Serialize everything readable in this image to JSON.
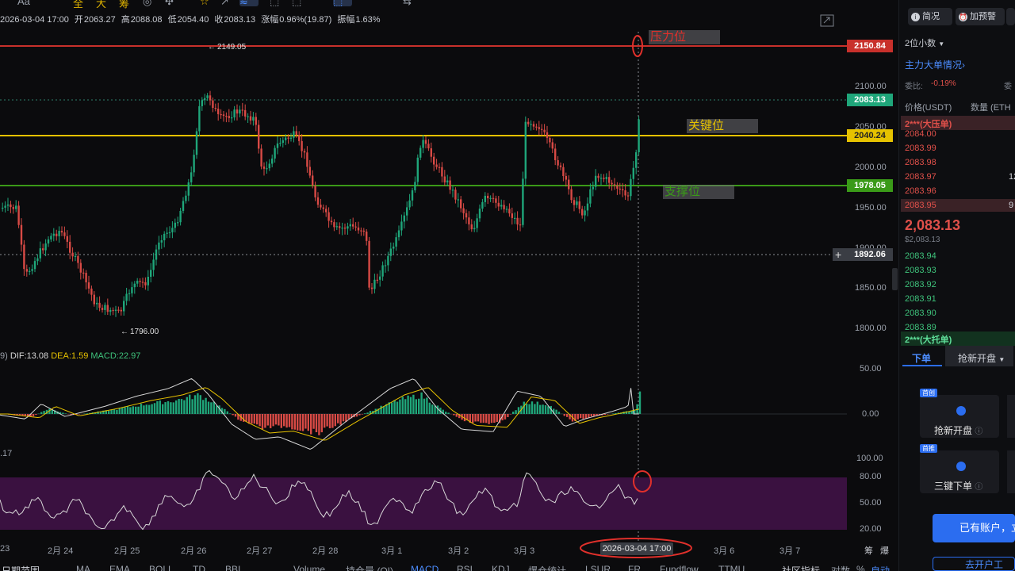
{
  "toolbar": {
    "text_tool": "Aa",
    "items": [
      "全",
      "大",
      "筹",
      "◎",
      "✣",
      "☆",
      "↗",
      "≋",
      "⬚",
      "⬚",
      "⬚",
      "⇆"
    ]
  },
  "ohlc": {
    "datetime": "2026-03-04 17:00",
    "open_label": "开",
    "open": "2063.27",
    "high_label": "高",
    "high": "2088.08",
    "low_label": "低",
    "low": "2054.40",
    "close_label": "收",
    "close": "2083.13",
    "change_label": "涨幅",
    "change": "0.96%(19.87)",
    "amplitude_label": "振幅",
    "amplitude": "1.63%"
  },
  "annotations": {
    "resistance": "压力位",
    "key": "关键位",
    "support": "支撑位",
    "high_marker": "2149.05",
    "low_marker": "1796.00"
  },
  "price_axis": [
    "2100.00",
    "2050.00",
    "2000.00",
    "1950.00",
    "1900.00",
    "1850.00",
    "1800.00"
  ],
  "price_tags": {
    "resistance": "2150.84",
    "current": "2083.13",
    "key": "2040.24",
    "support": "1978.05",
    "crosshair": "1892.06"
  },
  "colors": {
    "resistance": "#c8302b",
    "key": "#e6c200",
    "support": "#3a9a18",
    "up": "#1fa67a",
    "down": "#d84a45",
    "accent": "#2b6df0"
  },
  "macd": {
    "prefix": "9)",
    "dif_label": "DIF:",
    "dif": "13.08",
    "dea_label": "DEA:",
    "dea": "1.59",
    "macd_label": "MACD:",
    "macd": "22.97",
    "axis": [
      "50.00",
      "0.00"
    ]
  },
  "rsi": {
    "label": ".17",
    "axis": [
      "100.00",
      "80.00",
      "50.00",
      "20.00"
    ]
  },
  "dates": [
    "23",
    "2月 24",
    "2月 25",
    "2月 26",
    "2月 27",
    "2月 28",
    "3月 1",
    "3月 2",
    "3月 3",
    "3月 6",
    "3月 7"
  ],
  "cursor_date": "2026-03-04 17:00",
  "corner_labels": [
    "筹",
    "爆"
  ],
  "bottom_tabs": {
    "items": [
      "日期范围",
      "MA",
      "EMA",
      "BOLL",
      "TD",
      "BBI",
      "Volume",
      "持仓量 (OI)",
      "MACD",
      "RSI",
      "KDJ",
      "爆仓统计",
      "LSUR",
      "FR",
      "Fundflow",
      "TTMU",
      "社区指标",
      "对数",
      "%",
      "自动"
    ],
    "active": "MACD"
  },
  "panel": {
    "overview_btn": "简况",
    "alert_btn": "加预警",
    "decimals": "2位小数",
    "big_orders": "主力大单情况",
    "ratio_label": "委比:",
    "ratio": "-0.19%",
    "ratio_label2": "委",
    "col_price": "价格(USDT)",
    "col_qty": "数量 (ETH",
    "big_sell": "2***(大压单)",
    "asks": [
      "2084.00",
      "2083.99",
      "2083.98",
      "2083.97",
      "2083.96",
      "2083.95"
    ],
    "ask_qty": [
      "",
      "",
      "",
      "12",
      "",
      "9"
    ],
    "last_price": "2,083.13",
    "last_price_usd": "$2,083.13",
    "bids": [
      "2083.94",
      "2083.93",
      "2083.92",
      "2083.91",
      "2083.90",
      "2083.89"
    ],
    "big_buy": "2***(大托单)",
    "tab_order": "下单",
    "tab_open": "抢新开盘",
    "card1_tag": "首创",
    "card1": "抢新开盘",
    "card2_tag": "首推",
    "card2": "三键下单",
    "login": "已有账户，立",
    "bottom_link": "去开户工"
  }
}
